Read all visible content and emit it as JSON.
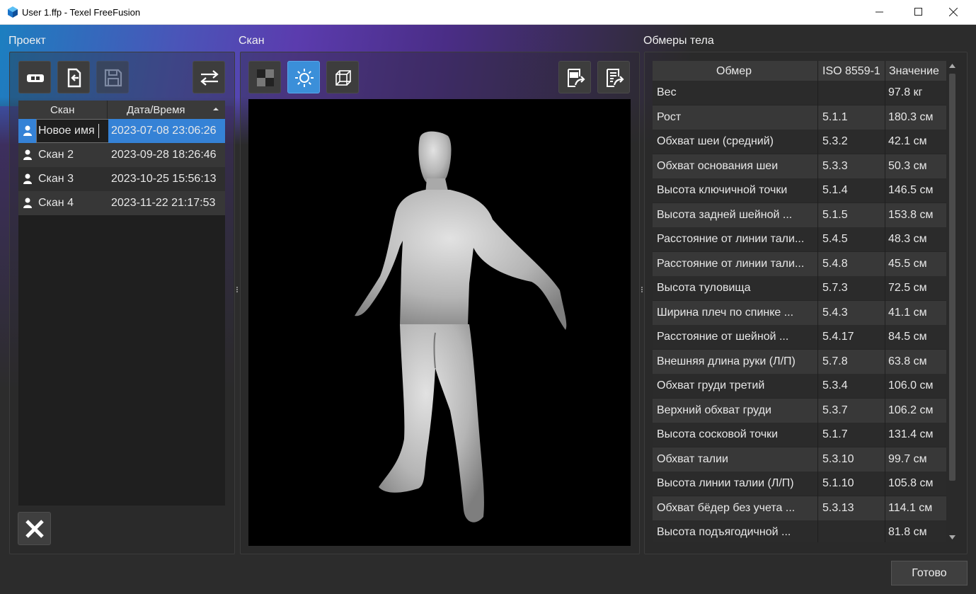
{
  "window": {
    "title": "User 1.ffp - Texel FreeFusion"
  },
  "sections": {
    "project": "Проект",
    "scan": "Скан",
    "measurements": "Обмеры тела"
  },
  "scan_list": {
    "columns": [
      "Скан",
      "Дата/Время"
    ],
    "rows": [
      {
        "name": "Новое имя",
        "date": "2023-07-08 23:06:26",
        "selected": true
      },
      {
        "name": "Скан 2",
        "date": "2023-09-28 18:26:46"
      },
      {
        "name": "Скан 3",
        "date": "2023-10-25 15:56:13"
      },
      {
        "name": "Скан 4",
        "date": "2023-11-22 21:17:53"
      }
    ]
  },
  "measurements": {
    "columns": [
      "Обмер",
      "ISO 8559-1",
      "Значение"
    ],
    "rows": [
      {
        "name": "Вес",
        "iso": "",
        "value": "97.8 кг"
      },
      {
        "name": "Рост",
        "iso": "5.1.1",
        "value": "180.3 см"
      },
      {
        "name": "Обхват шеи (средний)",
        "iso": "5.3.2",
        "value": "42.1 см"
      },
      {
        "name": "Обхват основания шеи",
        "iso": "5.3.3",
        "value": "50.3 см"
      },
      {
        "name": "Высота ключичной точки",
        "iso": "5.1.4",
        "value": "146.5 см"
      },
      {
        "name": "Высота задней шейной ...",
        "iso": "5.1.5",
        "value": "153.8 см"
      },
      {
        "name": "Расстояние от линии тали...",
        "iso": "5.4.5",
        "value": "48.3 см"
      },
      {
        "name": "Расстояние от линии тали...",
        "iso": "5.4.8",
        "value": "45.5 см"
      },
      {
        "name": "Высота туловища",
        "iso": "5.7.3",
        "value": "72.5 см"
      },
      {
        "name": "Ширина плеч по спинке ...",
        "iso": "5.4.3",
        "value": "41.1 см"
      },
      {
        "name": "Расстояние от шейной ...",
        "iso": "5.4.17",
        "value": "84.5 см"
      },
      {
        "name": "Внешняя длина руки (Л/П)",
        "iso": "5.7.8",
        "value": "63.8 см"
      },
      {
        "name": "Обхват груди третий",
        "iso": "5.3.4",
        "value": "106.0 см"
      },
      {
        "name": "Верхний обхват груди",
        "iso": "5.3.7",
        "value": "106.2 см"
      },
      {
        "name": "Высота сосковой точки",
        "iso": "5.1.7",
        "value": "131.4 см"
      },
      {
        "name": "Обхват талии",
        "iso": "5.3.10",
        "value": "99.7 см"
      },
      {
        "name": "Высота линии талии (Л/П)",
        "iso": "5.1.10",
        "value": "105.8 см"
      },
      {
        "name": "Обхват бёдер без учета ...",
        "iso": "5.3.13",
        "value": "114.1 см"
      },
      {
        "name": "Высота подъягодичной ...",
        "iso": "",
        "value": "81.8 см"
      }
    ]
  },
  "buttons": {
    "done": "Готово"
  },
  "colors": {
    "accent": "#3b8fd9",
    "selection": "#3582d6"
  }
}
